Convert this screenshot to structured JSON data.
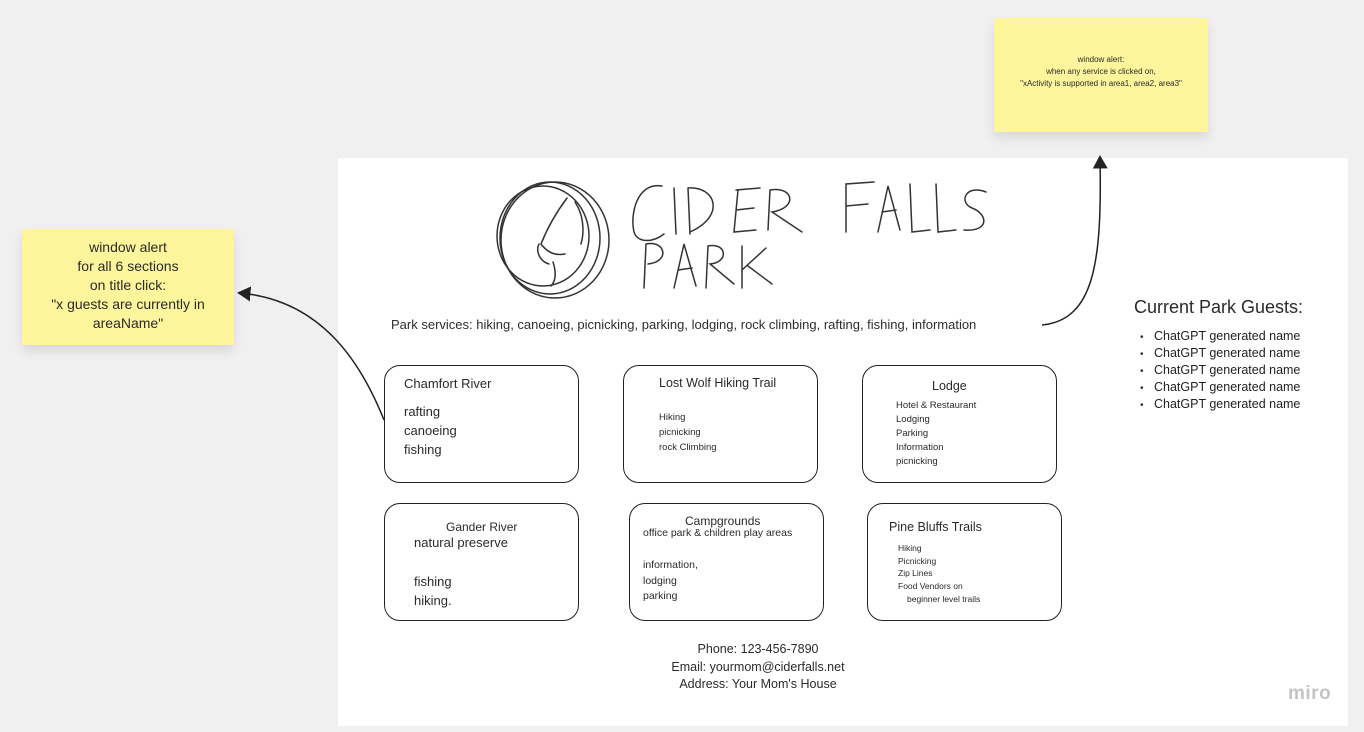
{
  "notes": {
    "top": "window alert:\nwhen any service is clicked on,\n\"xActivity is supported in area1, area2, area3\"",
    "left": "window alert\nfor all 6 sections\non title click:\n\"x guests are currently in\nareaName\""
  },
  "logo": {
    "text_line1": "CIDER FALLS",
    "text_line2": "PARK"
  },
  "services_line": "Park services: hiking, canoeing, picnicking, parking, lodging, rock climbing, rafting, fishing, information",
  "sections": [
    {
      "title": "Chamfort River",
      "items": [
        "rafting",
        "canoeing",
        "fishing"
      ]
    },
    {
      "title": "Lost Wolf Hiking Trail",
      "items": [
        "Hiking",
        "picnicking",
        "rock Climbing"
      ]
    },
    {
      "title": "Lodge",
      "items": [
        "Hotel & Restaurant",
        "Lodging",
        "Parking",
        "Information",
        "picnicking"
      ]
    },
    {
      "title": "Gander River",
      "subtitle": "natural preserve",
      "items": [
        "fishing",
        "hiking."
      ]
    },
    {
      "title": "Campgrounds",
      "subtitle": "office park & children play areas",
      "items": [
        "information,",
        "lodging",
        "parking"
      ]
    },
    {
      "title": "Pine Bluffs Trails",
      "items": [
        "Hiking",
        "Picnicking",
        "Zip Lines",
        "Food Vendors on",
        "beginner level trails"
      ]
    }
  ],
  "guests": {
    "title": "Current Park Guests:",
    "items": [
      "ChatGPT generated name",
      "ChatGPT generated name",
      "ChatGPT generated name",
      "ChatGPT generated name",
      "ChatGPT generated name"
    ]
  },
  "footer": {
    "phone": "Phone: 123-456-7890",
    "email": "Email: yourmom@ciderfalls.net",
    "address": "Address: Your Mom's House"
  },
  "brand": "miro",
  "colors": {
    "sticky": "#fdf59b",
    "canvas": "#f0f0f0",
    "frame": "#ffffff",
    "ink": "#222222"
  }
}
